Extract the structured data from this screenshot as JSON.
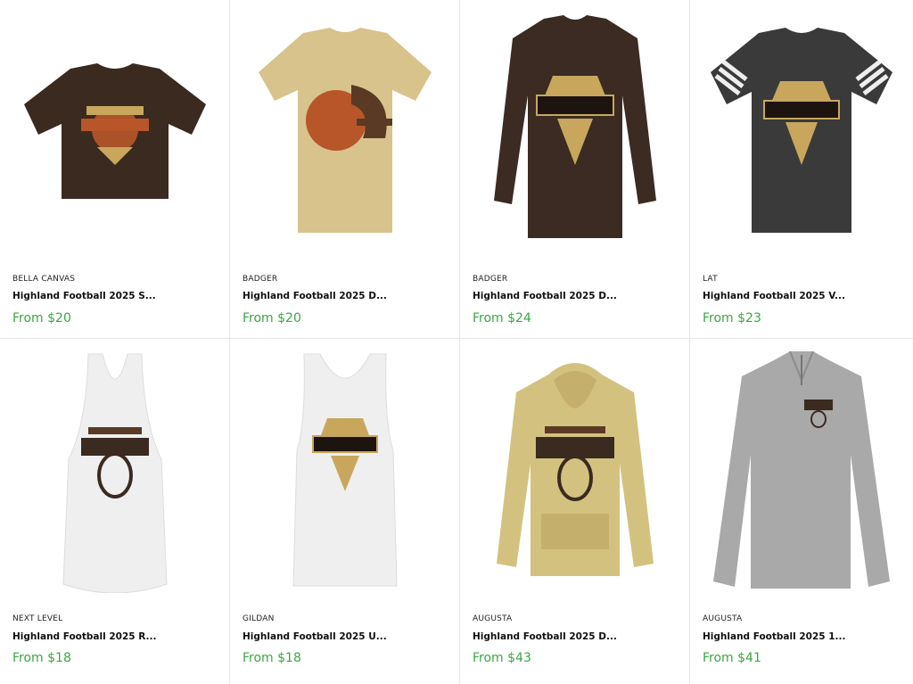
{
  "products": [
    {
      "brand": "BELLA CANVAS",
      "name": "Highland Football 2025 S...",
      "price": "From $20",
      "color": "#3b2a20",
      "style": "tshirt-icon"
    },
    {
      "brand": "BADGER",
      "name": "Highland Football 2025 D...",
      "price": "From $20",
      "color": "#d8c38d",
      "style": "tshirt-icon"
    },
    {
      "brand": "BADGER",
      "name": "Highland Football 2025 D...",
      "price": "From $24",
      "color": "#3b2b22",
      "style": "longsleeve-icon"
    },
    {
      "brand": "LAT",
      "name": "Highland Football 2025 V...",
      "price": "From $23",
      "color": "#3a3a3a",
      "style": "varsity-tshirt-icon"
    },
    {
      "brand": "NEXT LEVEL",
      "name": "Highland Football 2025 R...",
      "price": "From $18",
      "color": "#f1f1f1",
      "style": "racerback-tank-icon"
    },
    {
      "brand": "GILDAN",
      "name": "Highland Football 2025 U...",
      "price": "From $18",
      "color": "#f1f1f1",
      "style": "tank-icon"
    },
    {
      "brand": "AUGUSTA",
      "name": "Highland Football 2025 D...",
      "price": "From $43",
      "color": "#d3c27f",
      "style": "hoodie-icon"
    },
    {
      "brand": "AUGUSTA",
      "name": "Highland Football 2025 1...",
      "price": "From $41",
      "color": "#a9a9aa",
      "style": "quarter-zip-icon"
    }
  ],
  "graphic": {
    "brown": "#5a3a24",
    "gold": "#c8a75d",
    "orange": "#b8562a"
  }
}
